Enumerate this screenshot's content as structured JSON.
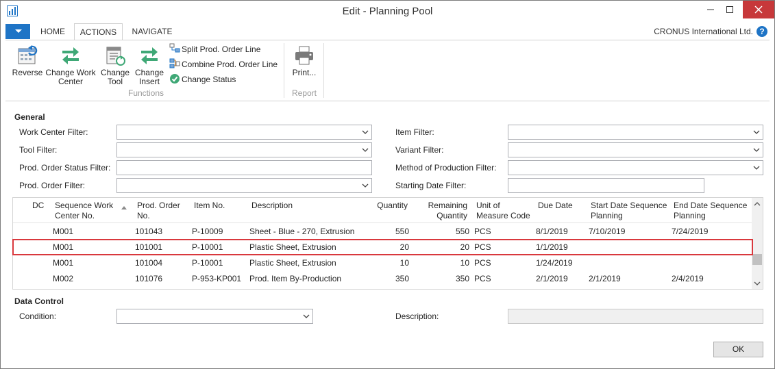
{
  "window": {
    "title": "Edit - Planning Pool"
  },
  "ribbon": {
    "tabs": [
      {
        "label": "HOME"
      },
      {
        "label": "ACTIONS"
      },
      {
        "label": "NAVIGATE"
      }
    ],
    "company": "CRONUS International Ltd.",
    "help": "?",
    "buttons": {
      "reverse": "Reverse",
      "change_work_center_1": "Change Work",
      "change_work_center_2": "Center",
      "change_tool_1": "Change",
      "change_tool_2": "Tool",
      "change_insert_1": "Change",
      "change_insert_2": "Insert",
      "split": "Split Prod. Order Line",
      "combine": "Combine Prod. Order Line",
      "change_status": "Change Status",
      "print": "Print..."
    },
    "groups": {
      "functions": "Functions",
      "report": "Report"
    }
  },
  "general": {
    "title": "General",
    "work_center_filter": "Work Center Filter:",
    "tool_filter": "Tool Filter:",
    "prod_order_status_filter": "Prod. Order Status Filter:",
    "prod_order_filter": "Prod. Order Filter:",
    "item_filter": "Item Filter:",
    "variant_filter": "Variant Filter:",
    "method_of_production_filter": "Method of Production Filter:",
    "starting_date_filter": "Starting Date Filter:"
  },
  "grid": {
    "headers": {
      "dc": "DC",
      "seq_wc_1": "Sequence Work",
      "seq_wc_2": "Center No.",
      "prod_order_1": "Prod. Order",
      "prod_order_2": "No.",
      "item_no": "Item No.",
      "description": "Description",
      "quantity": "Quantity",
      "remaining_1": "Remaining",
      "remaining_2": "Quantity",
      "uom_1": "Unit of",
      "uom_2": "Measure Code",
      "due_date": "Due Date",
      "start_seq_1": "Start Date Sequence",
      "start_seq_2": "Planning",
      "end_seq_1": "End Date Sequence",
      "end_seq_2": "Planning"
    },
    "rows": [
      {
        "wc": "M001",
        "prod_order": "101043",
        "item": "P-10009",
        "description": "Sheet - Blue - 270, Extrusion",
        "quantity": "550",
        "remaining": "550",
        "uom": "PCS",
        "due_date": "8/1/2019",
        "start_seq": "7/10/2019",
        "end_seq": "7/24/2019"
      },
      {
        "wc": "M001",
        "prod_order": "101001",
        "item": "P-10001",
        "description": "Plastic Sheet, Extrusion",
        "quantity": "20",
        "remaining": "20",
        "uom": "PCS",
        "due_date": "1/1/2019",
        "start_seq": "",
        "end_seq": ""
      },
      {
        "wc": "M001",
        "prod_order": "101004",
        "item": "P-10001",
        "description": "Plastic Sheet, Extrusion",
        "quantity": "10",
        "remaining": "10",
        "uom": "PCS",
        "due_date": "1/24/2019",
        "start_seq": "",
        "end_seq": ""
      },
      {
        "wc": "M002",
        "prod_order": "101076",
        "item": "P-953-KP001",
        "description": "Prod. Item By-Production",
        "quantity": "350",
        "remaining": "350",
        "uom": "PCS",
        "due_date": "2/1/2019",
        "start_seq": "2/1/2019",
        "end_seq": "2/4/2019"
      }
    ]
  },
  "data_control": {
    "title": "Data Control",
    "condition": "Condition:",
    "description": "Description:"
  },
  "footer": {
    "ok": "OK"
  },
  "colors": {
    "accent": "#1e74c6",
    "highlight": "#d9383d",
    "close": "#c7383a"
  }
}
